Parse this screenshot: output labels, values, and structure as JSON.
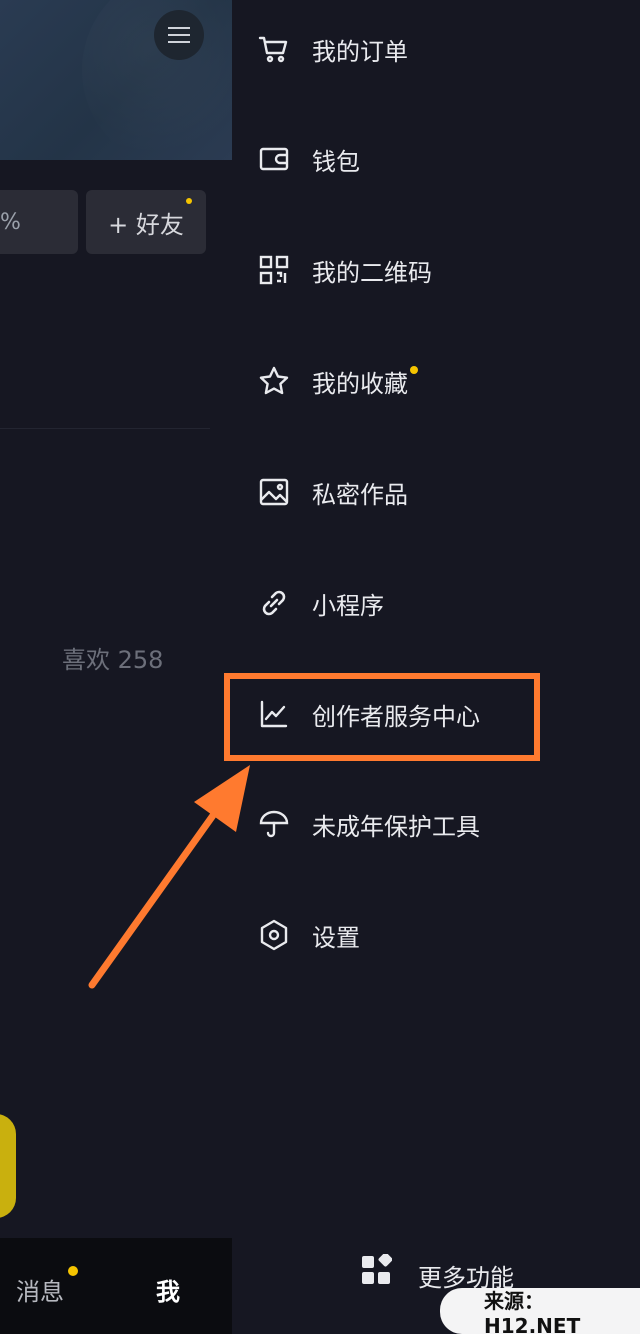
{
  "left_panel": {
    "partial_stat_text": "%",
    "add_friend_label": "+ 好友",
    "likes_text": "喜欢 258",
    "bottom_nav": {
      "messages_label": "消息",
      "me_label": "我"
    }
  },
  "drawer": {
    "items": [
      {
        "label": "我的订单",
        "icon": "cart-icon"
      },
      {
        "label": "钱包",
        "icon": "wallet-icon"
      },
      {
        "label": "我的二维码",
        "icon": "qrcode-icon"
      },
      {
        "label": "我的收藏",
        "icon": "star-icon",
        "has_badge": true
      },
      {
        "label": "私密作品",
        "icon": "image-icon"
      },
      {
        "label": "小程序",
        "icon": "link-icon"
      },
      {
        "label": "创作者服务中心",
        "icon": "chart-icon",
        "highlighted": true
      },
      {
        "label": "未成年保护工具",
        "icon": "umbrella-icon"
      },
      {
        "label": "设置",
        "icon": "settings-hexagon-icon"
      }
    ],
    "more_label": "更多功能"
  },
  "watermark_text": "来源：H12.NET",
  "colors": {
    "highlight": "#ff7a2f",
    "badge": "#f5c400",
    "drawer_bg": "#161722"
  }
}
